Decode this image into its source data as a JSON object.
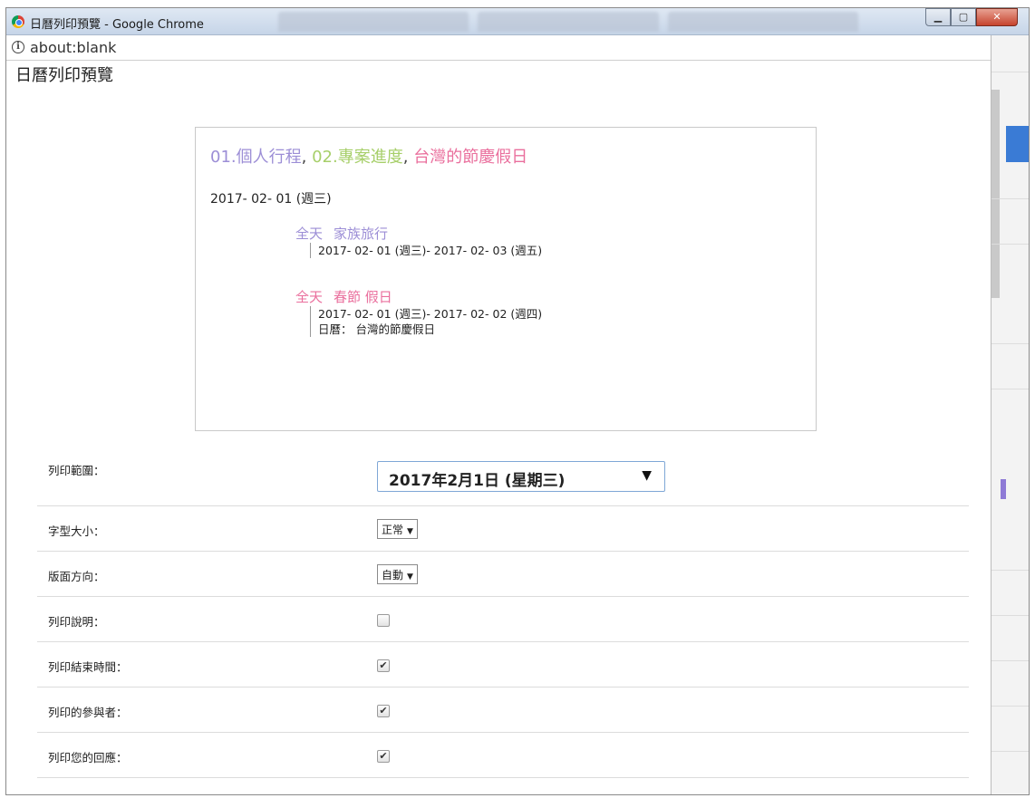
{
  "window": {
    "title": "日曆列印預覽 - Google Chrome",
    "url": "about:blank"
  },
  "page": {
    "heading": "日曆列印預覽"
  },
  "preview": {
    "title_parts": [
      {
        "text": "01.個人行程",
        "color": "#9c8ed6"
      },
      {
        "text": "02.專案進度",
        "color": "#a7cf6a"
      },
      {
        "text": "台灣的節慶假日",
        "color": "#ea6f9d"
      }
    ],
    "separator": ",",
    "day": "2017- 02- 01 (週三)",
    "events": [
      {
        "allday": "全天",
        "name": "家族旅行",
        "range": "2017- 02- 01 (週三)- 2017- 02- 03 (週五)",
        "calendar": ""
      },
      {
        "allday": "全天",
        "name": "春節 假日",
        "range": "2017- 02- 01 (週三)- 2017- 02- 02 (週四)",
        "calendar": "日曆： 台灣的節慶假日"
      }
    ]
  },
  "settings": {
    "range_label": "列印範圍：",
    "range_value": "2017年2月1日 (星期三)",
    "font_label": "字型大小：",
    "font_value": "正常",
    "orient_label": "版面方向：",
    "orient_value": "自動",
    "desc_label": "列印說明：",
    "desc_checked": false,
    "endtime_label": "列印結束時間：",
    "endtime_checked": true,
    "attendees_label": "列印的參與者：",
    "attendees_checked": true,
    "response_label": "列印您的回應：",
    "response_checked": true
  }
}
